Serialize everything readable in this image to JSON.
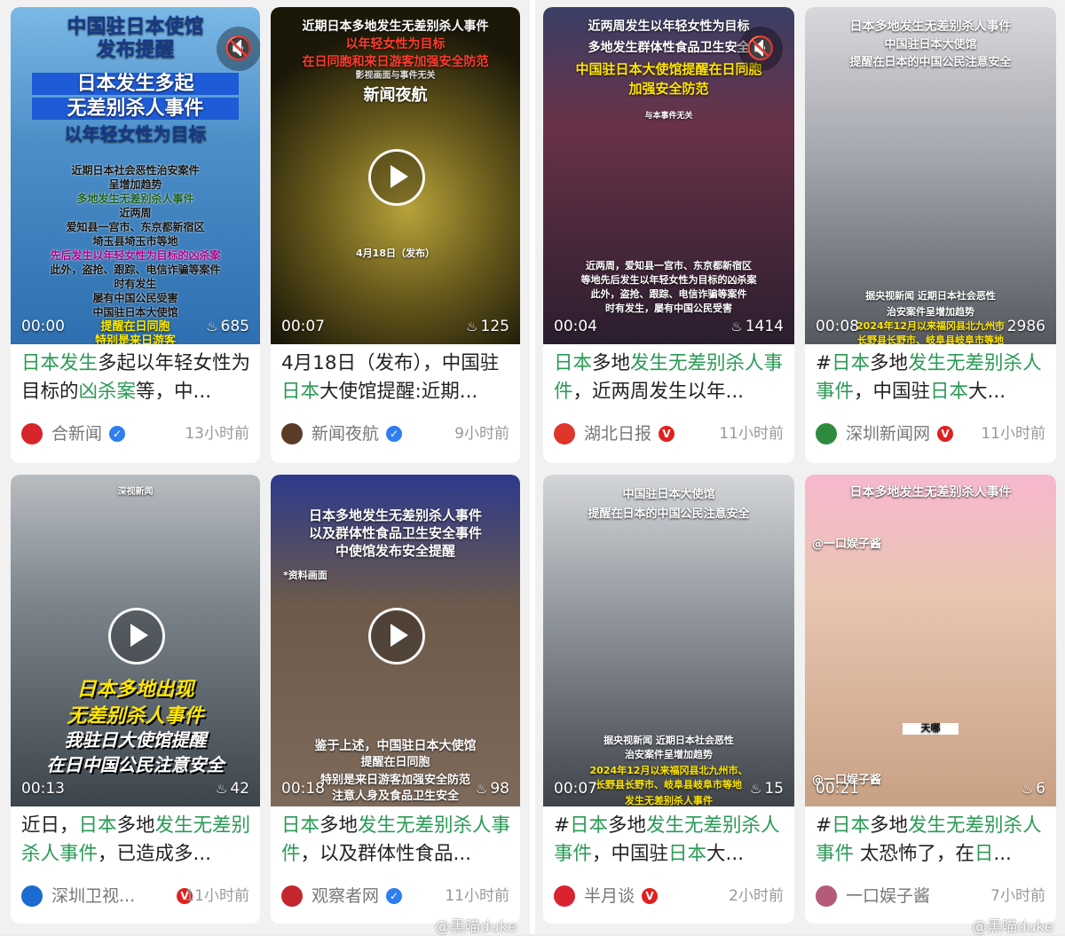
{
  "left_panel": {
    "watermark": "@黑喵duke",
    "cards": [
      {
        "overlay": [
          "中国驻日本使馆",
          "发布提醒",
          "日本发生多起",
          "无差别杀人事件",
          "以年轻女性为目标",
          "近期日本社会恶性治安案件",
          "呈增加趋势",
          "多地发生无差别杀人事件",
          "近两周",
          "爱知县一宫市、东京都新宿区",
          "埼玉县埼玉市等地",
          "先后发生以年轻女性为目标的凶杀案",
          "此外，盗抢、跟踪、电信诈骗等案件",
          "时有发生",
          "屡有中国公民受害",
          "中国驻日本大使馆",
          "提醒在日同胞",
          "特别是来日游客"
        ],
        "duration": "00:00",
        "likes": "685",
        "title": [
          {
            "t": "日本发生",
            "h": true
          },
          {
            "t": "多起以年轻女性为目标的",
            "h": false
          },
          {
            "t": "凶杀案",
            "h": true
          },
          {
            "t": "等，中...",
            "h": false
          }
        ],
        "author": "合新闻",
        "verified": "blue",
        "time": "13小时前"
      },
      {
        "overlay": [
          "近期日本多地发生无差别杀人事件",
          "以年轻女性为目标",
          "在日同胞和来日游客加强安全防范",
          "影视画面与事件无关",
          "新闻夜航",
          "4月18日（发布）"
        ],
        "duration": "00:07",
        "likes": "125",
        "title": [
          {
            "t": "4月18日（发布），中国驻",
            "h": false
          },
          {
            "t": "日本",
            "h": true
          },
          {
            "t": "大使馆提醒:近期...",
            "h": false
          }
        ],
        "author": "新闻夜航",
        "verified": "blue",
        "time": "9小时前"
      },
      {
        "overlay": [
          "深视新闻",
          "日本多地出现",
          "无差别杀人事件",
          "我驻日大使馆提醒",
          "在日中国公民注意安全"
        ],
        "duration": "00:13",
        "likes": "42",
        "title": [
          {
            "t": "近日，",
            "h": false
          },
          {
            "t": "日本",
            "h": true
          },
          {
            "t": "多地",
            "h": false
          },
          {
            "t": "发生无差别杀人事件",
            "h": true
          },
          {
            "t": "，已造成多...",
            "h": false
          }
        ],
        "author": "深圳卫视...",
        "verified": "red",
        "time": "11小时前"
      },
      {
        "overlay": [
          "日本多地发生无差别杀人事件",
          "以及群体性食品卫生安全事件",
          "中使馆发布安全提醒",
          "*资料画面",
          "鉴于上述，中国驻日本大使馆",
          "提醒在日同胞",
          "特别是来日游客加强安全防范",
          "注意人身及食品卫生安全"
        ],
        "duration": "00:18",
        "likes": "98",
        "title": [
          {
            "t": "日本",
            "h": true
          },
          {
            "t": "多地",
            "h": false
          },
          {
            "t": "发生无差别杀人",
            "h": true
          },
          {
            "t": "事件",
            "h": true
          },
          {
            "t": "，以及群体性食品...",
            "h": false
          }
        ],
        "author": "观察者网",
        "verified": "blue",
        "time": "11小时前"
      }
    ]
  },
  "right_panel": {
    "watermark": "@黑喵duke",
    "cards": [
      {
        "overlay": [
          "近两周发生以年轻女性为目标",
          "多地发生群体性食品卫生安全",
          "中国驻日本大使馆提醒在日同胞",
          "加强安全防范",
          "与本事件无关",
          "近两周，爱知县一宫市、东京都新宿区",
          "等地先后发生以年轻女性为目标的凶杀案",
          "此外，盗抢、跟踪、电信诈骗等案件",
          "时有发生，屡有中国公民受害"
        ],
        "duration": "00:04",
        "likes": "1414",
        "title": [
          {
            "t": "日本",
            "h": true
          },
          {
            "t": "多地",
            "h": false
          },
          {
            "t": "发生无差别杀人",
            "h": true
          },
          {
            "t": "事件",
            "h": true
          },
          {
            "t": "，近两周发生以年...",
            "h": false
          }
        ],
        "author": "湖北日报",
        "verified": "red",
        "time": "11小时前"
      },
      {
        "overlay": [
          "日本多地发生无差别杀人事件",
          "中国驻日本大使馆",
          "提醒在日本的中国公民注意安全",
          "据央视新闻 近期日本社会恶性",
          "治安案件呈增加趋势",
          "2024年12月以来福冈县北九州市",
          "长野县长野市、岐阜县岐阜市等地"
        ],
        "duration": "00:08",
        "likes": "2986",
        "title": [
          {
            "t": "#",
            "h": false
          },
          {
            "t": "日本",
            "h": true
          },
          {
            "t": "多地",
            "h": false
          },
          {
            "t": "发生无差别杀",
            "h": true
          },
          {
            "t": "人事件",
            "h": true
          },
          {
            "t": "，中国驻",
            "h": false
          },
          {
            "t": "日本",
            "h": true
          },
          {
            "t": "大...",
            "h": false
          }
        ],
        "author": "深圳新闻网",
        "verified": "red",
        "time": "11小时前"
      },
      {
        "overlay": [
          "中国驻日本大使馆",
          "提醒在日本的中国公民注意安全",
          "据央视新闻 近期日本社会恶性",
          "治安案件呈增加趋势",
          "2024年12月以来福冈县北九州市、",
          "长野县长野市、岐阜县岐阜市等地",
          "发生无差别杀人事件"
        ],
        "duration": "00:07",
        "likes": "15",
        "title": [
          {
            "t": "#",
            "h": false
          },
          {
            "t": "日本",
            "h": true
          },
          {
            "t": "多地",
            "h": false
          },
          {
            "t": "发生无差别杀",
            "h": true
          },
          {
            "t": "人事件",
            "h": true
          },
          {
            "t": "，中国驻",
            "h": false
          },
          {
            "t": "日本",
            "h": true
          },
          {
            "t": "大...",
            "h": false
          }
        ],
        "author": "半月谈",
        "verified": "red",
        "time": "2小时前"
      },
      {
        "overlay": [
          "日本多地发生无差别杀人事件",
          "@一口娱子酱",
          "天哪",
          "@一口娱子酱"
        ],
        "duration": "00:21",
        "likes": "6",
        "title": [
          {
            "t": "#",
            "h": false
          },
          {
            "t": "日本",
            "h": true
          },
          {
            "t": "多地",
            "h": false
          },
          {
            "t": "发生无差别杀",
            "h": true
          },
          {
            "t": "人事件",
            "h": true
          },
          {
            "t": " 太恐怖了，在",
            "h": false
          },
          {
            "t": "日",
            "h": true
          },
          {
            "t": "...",
            "h": false
          }
        ],
        "author": "一口娱子酱",
        "verified": "",
        "time": "7小时前"
      }
    ]
  },
  "colors": {
    "highlight": "#2a9a55",
    "verified_blue": "#2e7ef0",
    "verified_red": "#e02020"
  },
  "icons": {
    "play": "play-icon",
    "mute": "mute-icon",
    "likes": "flame-icon"
  }
}
